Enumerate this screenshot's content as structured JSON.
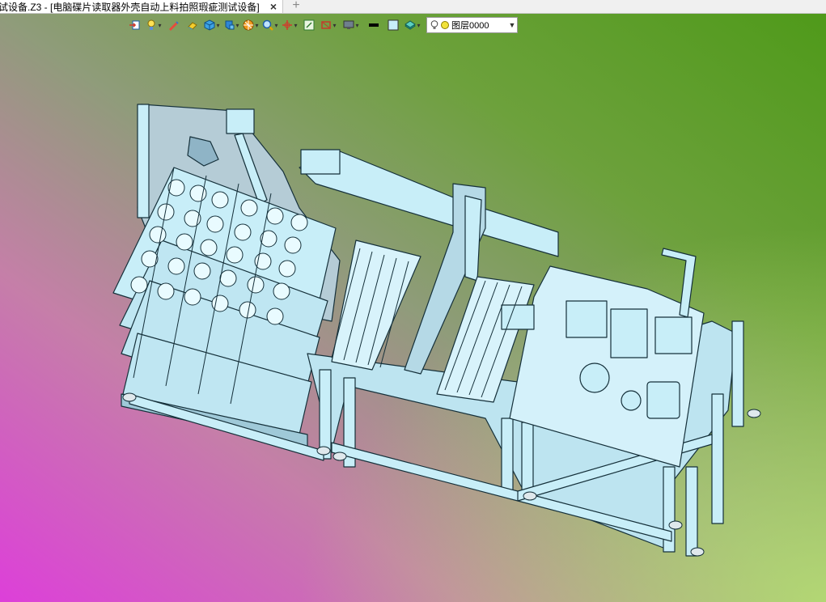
{
  "tab": {
    "title": "试设备.Z3 - [电脑碟片读取器外壳自动上料拍照瑕疵测试设备]",
    "close_glyph": "×",
    "new_glyph": "+"
  },
  "toolbar": {
    "icons": [
      "import-icon",
      "light-icon",
      "pen-icon",
      "eraser-icon",
      "cube-icon",
      "part-icon",
      "render-icon",
      "zoom-icon",
      "axis-icon",
      "snap-icon",
      "section-icon",
      "display-icon",
      "line-color-icon",
      "fill-color-icon",
      "layer-stack-icon"
    ],
    "layer": {
      "name": "图层0000",
      "dropdown_glyph": "▼"
    }
  },
  "colors": {
    "model_fill": "#c8eef8",
    "model_stroke": "#15303a",
    "bg_top_right": "#4f9a1a",
    "bg_bottom_left": "#dd3fd9"
  }
}
